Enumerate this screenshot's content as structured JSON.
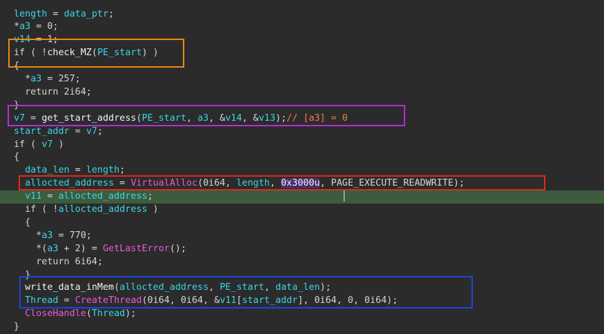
{
  "colors": {
    "background": "#2b2b2b",
    "highlight_line": "#3d5c3d",
    "identifier": "#3ad6e8",
    "import_function": "#ea5bd6",
    "comment": "#f37a4f",
    "box_orange": "#f0890f",
    "box_purple": "#bc2bd8",
    "box_red": "#e8271a",
    "box_blue": "#1b46e3"
  },
  "code_lines": [
    [
      [
        "id",
        "length"
      ],
      [
        "txt",
        " = "
      ],
      [
        "id",
        "data_ptr"
      ],
      [
        "txt",
        ";"
      ]
    ],
    [
      [
        "txt",
        "*"
      ],
      [
        "id",
        "a3"
      ],
      [
        "txt",
        " = 0;"
      ]
    ],
    [
      [
        "id",
        "v14"
      ],
      [
        "txt",
        " = 1;"
      ]
    ],
    [
      [
        "txt",
        "if ( !"
      ],
      [
        "fn",
        "check_MZ"
      ],
      [
        "txt",
        "("
      ],
      [
        "id",
        "PE_start"
      ],
      [
        "txt",
        ") )"
      ]
    ],
    [
      [
        "txt",
        "{"
      ]
    ],
    [
      [
        "txt",
        "  *"
      ],
      [
        "id",
        "a3"
      ],
      [
        "txt",
        " = 257;"
      ]
    ],
    [
      [
        "txt",
        "  return 2i64;"
      ]
    ],
    [
      [
        "txt",
        "}"
      ]
    ],
    [
      [
        "id",
        "v7"
      ],
      [
        "txt",
        " = "
      ],
      [
        "fn",
        "get_start_address"
      ],
      [
        "txt",
        "("
      ],
      [
        "id",
        "PE_start"
      ],
      [
        "txt",
        ", "
      ],
      [
        "id",
        "a3"
      ],
      [
        "txt",
        ", &"
      ],
      [
        "id",
        "v14"
      ],
      [
        "txt",
        ", &"
      ],
      [
        "id",
        "v13"
      ],
      [
        "txt",
        ");"
      ],
      [
        "cmt",
        "// [a3] = 0"
      ]
    ],
    [
      [
        "id",
        "start_addr"
      ],
      [
        "txt",
        " = "
      ],
      [
        "id",
        "v7"
      ],
      [
        "txt",
        ";"
      ]
    ],
    [
      [
        "txt",
        "if ( "
      ],
      [
        "id",
        "v7"
      ],
      [
        "txt",
        " )"
      ]
    ],
    [
      [
        "txt",
        "{"
      ]
    ],
    [
      [
        "txt",
        "  "
      ],
      [
        "id",
        "data_len"
      ],
      [
        "txt",
        " = "
      ],
      [
        "id",
        "length"
      ],
      [
        "txt",
        ";"
      ]
    ],
    [
      [
        "txt",
        "  "
      ],
      [
        "id",
        "allocted_address"
      ],
      [
        "txt",
        " = "
      ],
      [
        "imp",
        "VirtualAlloc"
      ],
      [
        "txt",
        "(0i64, "
      ],
      [
        "id",
        "length"
      ],
      [
        "txt",
        ", "
      ],
      [
        "sel",
        "0x3000u"
      ],
      [
        "txt",
        ", PAGE_EXECUTE_READWRITE);"
      ]
    ],
    [
      [
        "txt",
        "  "
      ],
      [
        "id",
        "v11"
      ],
      [
        "txt",
        " = "
      ],
      [
        "id",
        "allocted_address"
      ],
      [
        "txt",
        ";"
      ]
    ],
    [
      [
        "txt",
        "  if ( !"
      ],
      [
        "id",
        "allocted_address"
      ],
      [
        "txt",
        " )"
      ]
    ],
    [
      [
        "txt",
        "  {"
      ]
    ],
    [
      [
        "txt",
        "    *"
      ],
      [
        "id",
        "a3"
      ],
      [
        "txt",
        " = 770;"
      ]
    ],
    [
      [
        "txt",
        "    *("
      ],
      [
        "id",
        "a3"
      ],
      [
        "txt",
        " + 2) = "
      ],
      [
        "imp",
        "GetLastError"
      ],
      [
        "txt",
        "();"
      ]
    ],
    [
      [
        "txt",
        "    return 6i64;"
      ]
    ],
    [
      [
        "txt",
        "  }"
      ]
    ],
    [
      [
        "txt",
        "  "
      ],
      [
        "fn",
        "write_data_inMem"
      ],
      [
        "txt",
        "("
      ],
      [
        "id",
        "allocted_address"
      ],
      [
        "txt",
        ", "
      ],
      [
        "id",
        "PE_start"
      ],
      [
        "txt",
        ", "
      ],
      [
        "id",
        "data_len"
      ],
      [
        "txt",
        ");"
      ]
    ],
    [
      [
        "txt",
        "  "
      ],
      [
        "id",
        "Thread"
      ],
      [
        "txt",
        " = "
      ],
      [
        "imp",
        "CreateThread"
      ],
      [
        "txt",
        "(0i64, 0i64, &"
      ],
      [
        "id",
        "v11"
      ],
      [
        "txt",
        "["
      ],
      [
        "id",
        "start_addr"
      ],
      [
        "txt",
        "], 0i64, 0, 0i64);"
      ]
    ],
    [
      [
        "txt",
        "  "
      ],
      [
        "imp",
        "CloseHandle"
      ],
      [
        "txt",
        "("
      ],
      [
        "id",
        "Thread"
      ],
      [
        "txt",
        ");"
      ]
    ],
    [
      [
        "txt",
        "}"
      ]
    ]
  ],
  "highlighted_line_index": 14
}
